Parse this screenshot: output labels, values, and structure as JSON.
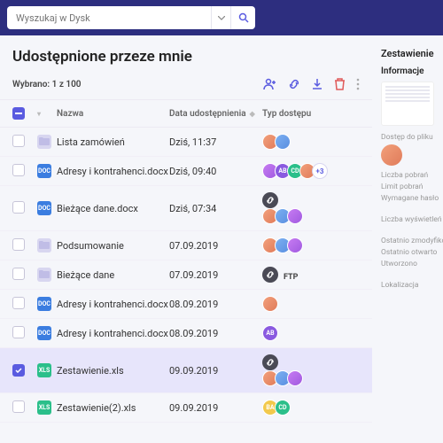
{
  "search": {
    "placeholder": "Wyszukaj w Dysk"
  },
  "page_title": "Udostępnione przeze mnie",
  "selection_info": "Wybrano: 1 z 100",
  "headers": {
    "name": "Nazwa",
    "date": "Data udostępnienia",
    "access": "Typ dostępu"
  },
  "rows": [
    {
      "icon": "folder",
      "name": "Lista zamówień",
      "date": "Dziś, 11:37",
      "access": {
        "link": false,
        "avatars": [
          "p1",
          "p2"
        ]
      }
    },
    {
      "icon": "docx",
      "name": "Adresy i kontrahenci.docx",
      "date": "Dziś, 09:40",
      "access": {
        "link": false,
        "avatars": [
          "p3",
          "ab",
          "cd",
          "p1"
        ],
        "more": "+3"
      }
    },
    {
      "icon": "docx",
      "name": "Bieżące dane.docx",
      "date": "Dziś, 07:34",
      "access": {
        "link": true,
        "avatars": [
          "p1",
          "p2",
          "p3"
        ]
      }
    },
    {
      "icon": "folder",
      "name": "Podsumowanie",
      "date": "07.09.2019",
      "access": {
        "link": false,
        "avatars": [
          "p1",
          "p2",
          "p3"
        ]
      }
    },
    {
      "icon": "folder",
      "name": "Bieżące dane",
      "date": "07.09.2019",
      "access": {
        "link": true,
        "ftp": "FTP"
      }
    },
    {
      "icon": "docx",
      "name": "Adresy i kontrahenci.docx",
      "date": "08.09.2019",
      "access": {
        "link": false,
        "avatars": [
          "p1"
        ]
      }
    },
    {
      "icon": "docx",
      "name": "Adresy i kontrahenci.docx",
      "date": "08.09.2019",
      "access": {
        "link": false,
        "avatars": [
          "ab"
        ]
      }
    },
    {
      "icon": "xls",
      "name": "Zestawienie.xls",
      "date": "09.09.2019",
      "selected": true,
      "access": {
        "link": true,
        "avatars": [
          "p1",
          "p2",
          "p3"
        ]
      }
    },
    {
      "icon": "xls",
      "name": "Zestawienie(2).xls",
      "date": "09.09.2019",
      "access": {
        "link": false,
        "avatars": [
          "ba",
          "cd"
        ]
      }
    }
  ],
  "side": {
    "title": "Zestawienie",
    "info_label": "Informacje",
    "thumb_lines": [
      "24 zł",
      "37 zł",
      "1 zł",
      "14 zł",
      "138 zł"
    ],
    "meta": [
      "Dostęp do pliku",
      "Liczba pobrań",
      "Limit pobrań",
      "Wymagane hasło",
      "Liczba wyświetleń",
      "Ostatnio zmodyfikowano",
      "Ostatnio otwarto",
      "Utworzono",
      "Lokalizacja"
    ]
  },
  "avatar_text": {
    "ab": "AB",
    "cd": "CD",
    "ba": "BA"
  }
}
